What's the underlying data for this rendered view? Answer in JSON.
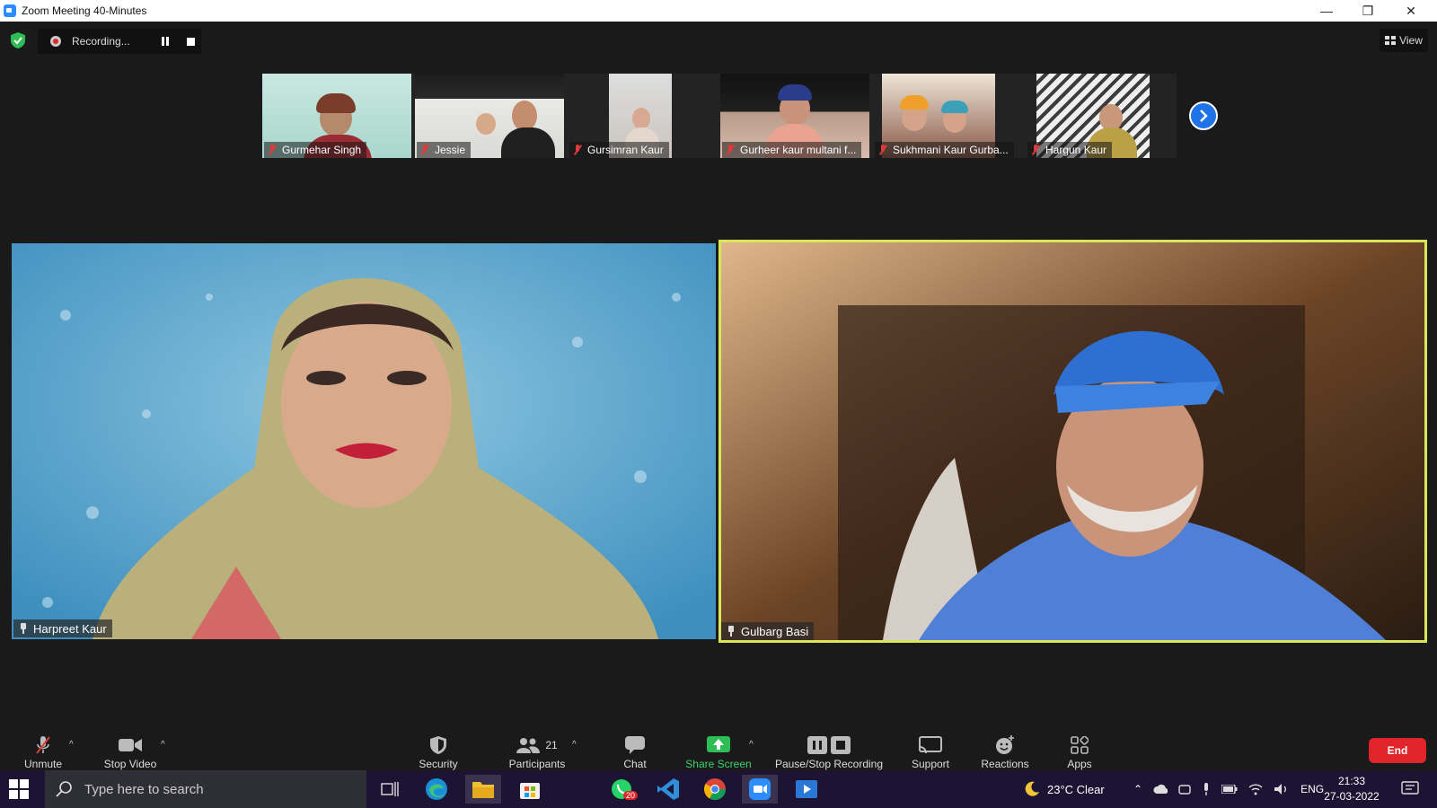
{
  "window": {
    "title": "Zoom Meeting 40-Minutes",
    "controls": {
      "minimize": "—",
      "restore": "❐",
      "close": "✕"
    }
  },
  "meeting": {
    "recording_label": "Recording...",
    "view_label": "View",
    "accent_color": "#2d8cff",
    "active_speaker_border": "#d9e65a"
  },
  "strip": {
    "participants": [
      {
        "name": "Gurmehar Singh"
      },
      {
        "name": "Jessie"
      },
      {
        "name": "Gursimran Kaur"
      },
      {
        "name": "Gurheer kaur multani f..."
      },
      {
        "name": "Sukhmani Kaur Gurba..."
      },
      {
        "name": "Hargun Kaur"
      }
    ]
  },
  "main": {
    "left_name": "Harpreet Kaur",
    "right_name": "Gulbarg Basi"
  },
  "toolbar": {
    "unmute": "Unmute",
    "stop_video": "Stop Video",
    "security": "Security",
    "participants": "Participants",
    "participants_count": "21",
    "chat": "Chat",
    "share_screen": "Share Screen",
    "pause_stop_recording": "Pause/Stop Recording",
    "support": "Support",
    "reactions": "Reactions",
    "apps": "Apps",
    "end": "End"
  },
  "taskbar": {
    "search_placeholder": "Type here to search",
    "chat_badge": "20",
    "weather": "23°C  Clear",
    "language": "ENG",
    "time": "21:33",
    "date": "27-03-2022"
  }
}
